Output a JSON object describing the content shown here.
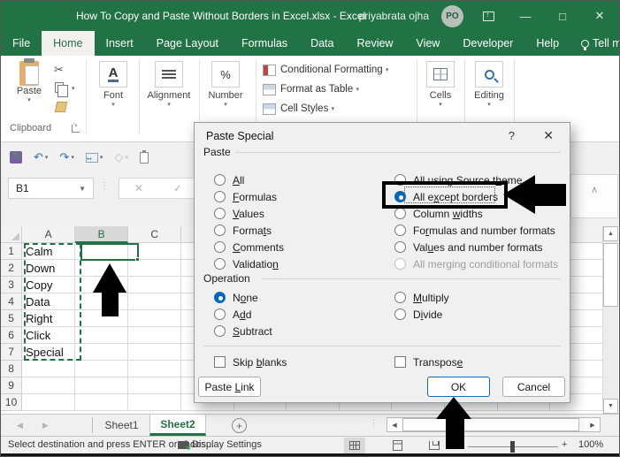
{
  "window": {
    "title": "How To Copy and Paste Without Borders in Excel.xlsx  -  Excel",
    "user": "priyabrata ojha",
    "avatar": "PO",
    "minimize": "—",
    "maximize": "□",
    "close": "✕"
  },
  "menu": {
    "tabs": [
      "File",
      "Home",
      "Insert",
      "Page Layout",
      "Formulas",
      "Data",
      "Review",
      "View",
      "Developer",
      "Help"
    ],
    "active_tab": "Home",
    "tell_me": "Tell me"
  },
  "ribbon": {
    "paste": "Paste",
    "clipboard_group": "Clipboard",
    "font_group": "Font",
    "alignment_group": "Alignment",
    "number_group": "Number",
    "number_icon": "%",
    "styles": [
      "Conditional Formatting",
      "Format as Table",
      "Cell Styles"
    ],
    "cells_group": "Cells",
    "editing_group": "Editing"
  },
  "formula_bar": {
    "name_box": "B1",
    "cancel": "✕",
    "enter": "✓"
  },
  "grid": {
    "columns": [
      "A",
      "B",
      "C"
    ],
    "selected_column": "B",
    "rows": [
      "1",
      "2",
      "3",
      "4",
      "5",
      "6",
      "7",
      "8",
      "9",
      "10"
    ],
    "cells": {
      "A": [
        "Calm",
        "Down",
        "Copy",
        "Data",
        "Right",
        "Click",
        "Special"
      ]
    }
  },
  "dialog": {
    "title": "Paste Special",
    "help": "?",
    "close": "✕",
    "paste_label": "Paste",
    "paste_left": [
      {
        "pre": "",
        "u": "A",
        "post": "ll"
      },
      {
        "pre": "",
        "u": "F",
        "post": "ormulas"
      },
      {
        "pre": "",
        "u": "V",
        "post": "alues"
      },
      {
        "pre": "Forma",
        "u": "t",
        "post": "s"
      },
      {
        "pre": "",
        "u": "C",
        "post": "omments"
      },
      {
        "pre": "Validatio",
        "u": "n",
        "post": ""
      }
    ],
    "paste_right": [
      {
        "pre": "All using Source t",
        "u": "h",
        "post": "eme"
      },
      {
        "pre": "All e",
        "u": "x",
        "post": "cept borders"
      },
      {
        "pre": "Column ",
        "u": "w",
        "post": "idths"
      },
      {
        "pre": "Fo",
        "u": "r",
        "post": "mulas and number formats"
      },
      {
        "pre": "Val",
        "u": "u",
        "post": "es and number formats"
      },
      {
        "pre": "All mer",
        "u": "g",
        "post": "ing conditional formats"
      }
    ],
    "operation_label": "Operation",
    "operation_left": [
      {
        "pre": "N",
        "u": "o",
        "post": "ne"
      },
      {
        "pre": "A",
        "u": "d",
        "post": "d"
      },
      {
        "pre": "",
        "u": "S",
        "post": "ubtract"
      }
    ],
    "operation_right": [
      {
        "pre": "",
        "u": "M",
        "post": "ultiply"
      },
      {
        "pre": "D",
        "u": "i",
        "post": "vide"
      }
    ],
    "skip_blanks": {
      "pre": "Skip ",
      "u": "b",
      "post": "lanks"
    },
    "transpose": {
      "pre": "Transpos",
      "u": "e",
      "post": ""
    },
    "paste_link": {
      "pre": "Paste ",
      "u": "L",
      "post": "ink"
    },
    "ok": "OK",
    "cancel": "Cancel"
  },
  "sheet_bar": {
    "tabs": [
      "Sheet1",
      "Sheet2"
    ],
    "active_tab": "Sheet2",
    "add": "+"
  },
  "status_bar": {
    "message": "Select destination and press ENTER or choos...",
    "display_settings": "Display Settings",
    "zoom_out": "−",
    "zoom_in": "+",
    "zoom_value": "100%"
  },
  "colors": {
    "excel_green": "#217346",
    "radio_blue": "#0067c0",
    "ok_border_blue": "#0f6cbd",
    "annotation_black": "#000000"
  }
}
